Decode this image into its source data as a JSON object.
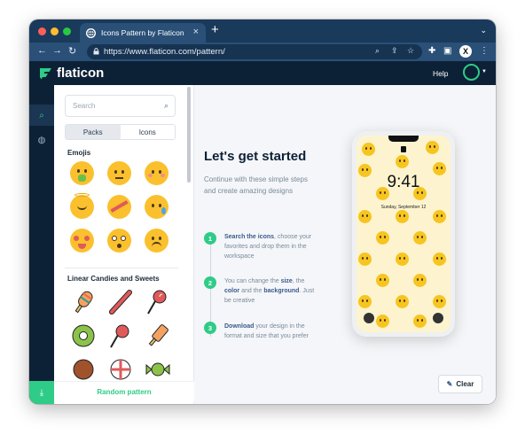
{
  "browser": {
    "tab_title": "Icons Pattern by Flaticon",
    "tab_close": "×",
    "new_tab": "+",
    "url": "https://www.flaticon.com/pattern/",
    "profile_initial": "X",
    "colors": {
      "frame": "#1a3a5c",
      "toolbar": "#2a5078",
      "close": "#ff5f57",
      "minimize": "#febc2e",
      "maximize": "#28c840"
    }
  },
  "site": {
    "logo_text": "flaticon",
    "help_label": "Help",
    "colors": {
      "header": "#0d2136",
      "accent": "#2ecc87"
    }
  },
  "rail": {
    "items": [
      "search-icon",
      "palette-icon",
      "share-icon",
      "download-icon"
    ]
  },
  "panel": {
    "search_placeholder": "Search",
    "tabs": [
      "Packs",
      "Icons"
    ],
    "active_tab": "Packs",
    "categories": [
      {
        "title": "Emojis"
      },
      {
        "title": "Linear Candies and Sweets"
      }
    ],
    "random_label": "Random pattern"
  },
  "main": {
    "title": "Let's get started",
    "intro": "Continue with these simple steps and create amazing designs",
    "steps": [
      {
        "num": "1",
        "bold": "Search the icons",
        "rest": ", choose your favorites and drop them in the workspace"
      },
      {
        "num": "2",
        "pre": "You can change the ",
        "bold1": "size",
        "mid1": ", the ",
        "bold2": "color",
        "mid2": " and the ",
        "bold3": "background",
        "rest": ". Just be creative"
      },
      {
        "num": "3",
        "bold": "Download",
        "rest": " your design in the format and size that you prefer"
      }
    ],
    "phone": {
      "time": "9:41",
      "date": "Sunday, September 12"
    },
    "clear_label": "Clear"
  }
}
